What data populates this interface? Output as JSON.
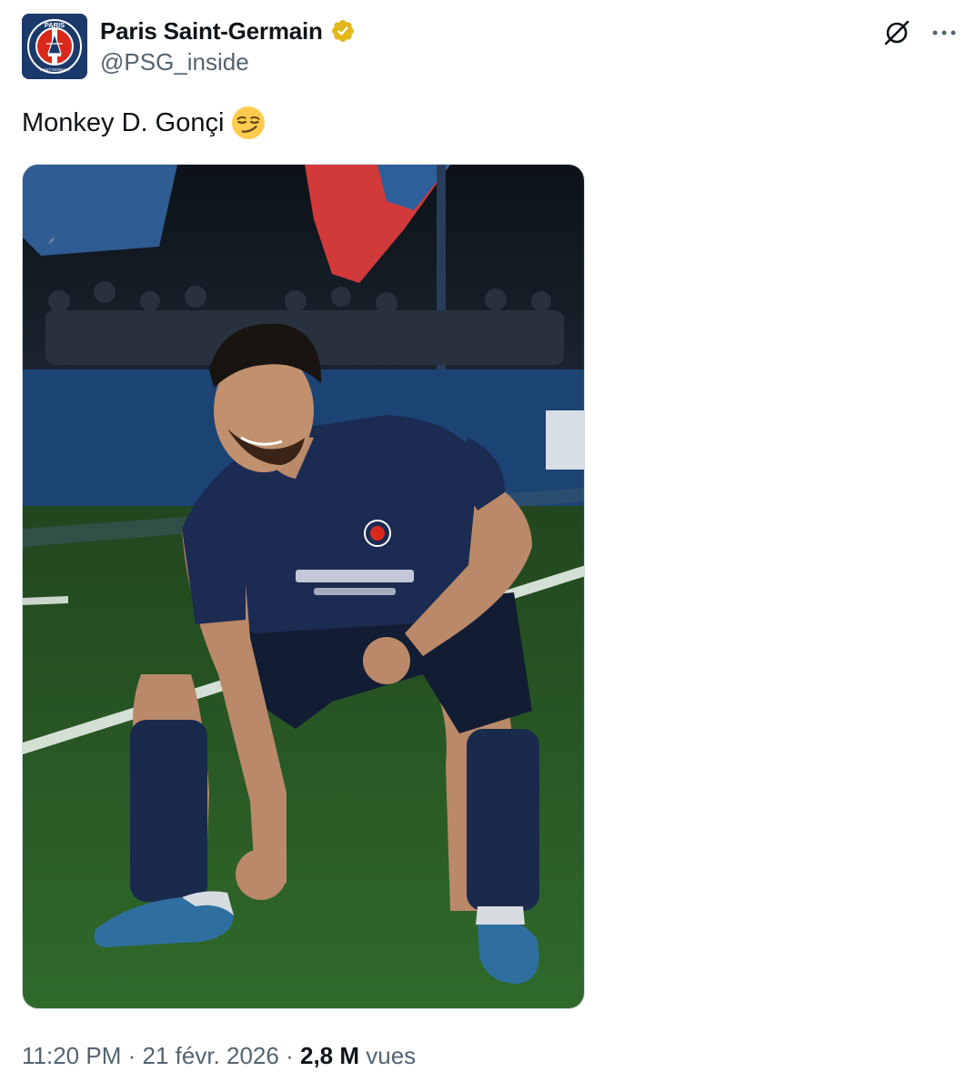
{
  "author": {
    "name": "Paris Saint-Germain",
    "handle": "@PSG_inside",
    "avatar_text_top": "PARIS",
    "avatar_text_bottom": "SAINT-GERMAIN",
    "verified_color": "#e2b719"
  },
  "tweet": {
    "text": "Monkey D. Gonçi",
    "emoji": "smirking-face",
    "media_alt": "Photo"
  },
  "meta": {
    "time": "11:20 PM",
    "separator": "·",
    "date": "21 févr. 2026",
    "views_count": "2,8 M",
    "views_label": "vues"
  },
  "icons": {
    "grok": "grok-icon",
    "more": "more-icon"
  },
  "colors": {
    "text_primary": "#0f1419",
    "text_secondary": "#536471",
    "psg_navy": "#1b3a6b",
    "psg_red": "#da291c"
  }
}
